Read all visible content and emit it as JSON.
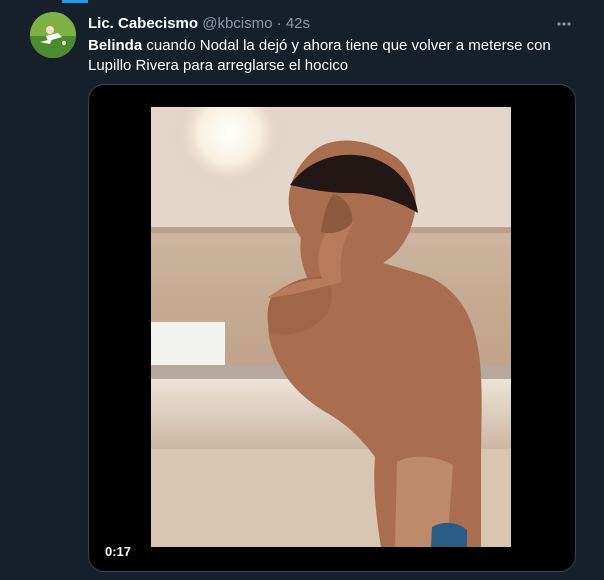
{
  "tweet": {
    "display_name": "Lic. Cabecismo",
    "handle": "@kbcismo",
    "separator": "·",
    "time": "42s",
    "text_mention": "Belinda",
    "text_body": " cuando Nodal la dejó y ahora tiene que volver a meterse con Lupillo Rivera para arreglarse el hocico",
    "more_icon": "more-horizontal-icon"
  },
  "video": {
    "duration": "0:17"
  },
  "colors": {
    "background": "#15202b",
    "secondary_text": "#8b98a5",
    "accent": "#1d9bf0",
    "border": "#38444d"
  }
}
